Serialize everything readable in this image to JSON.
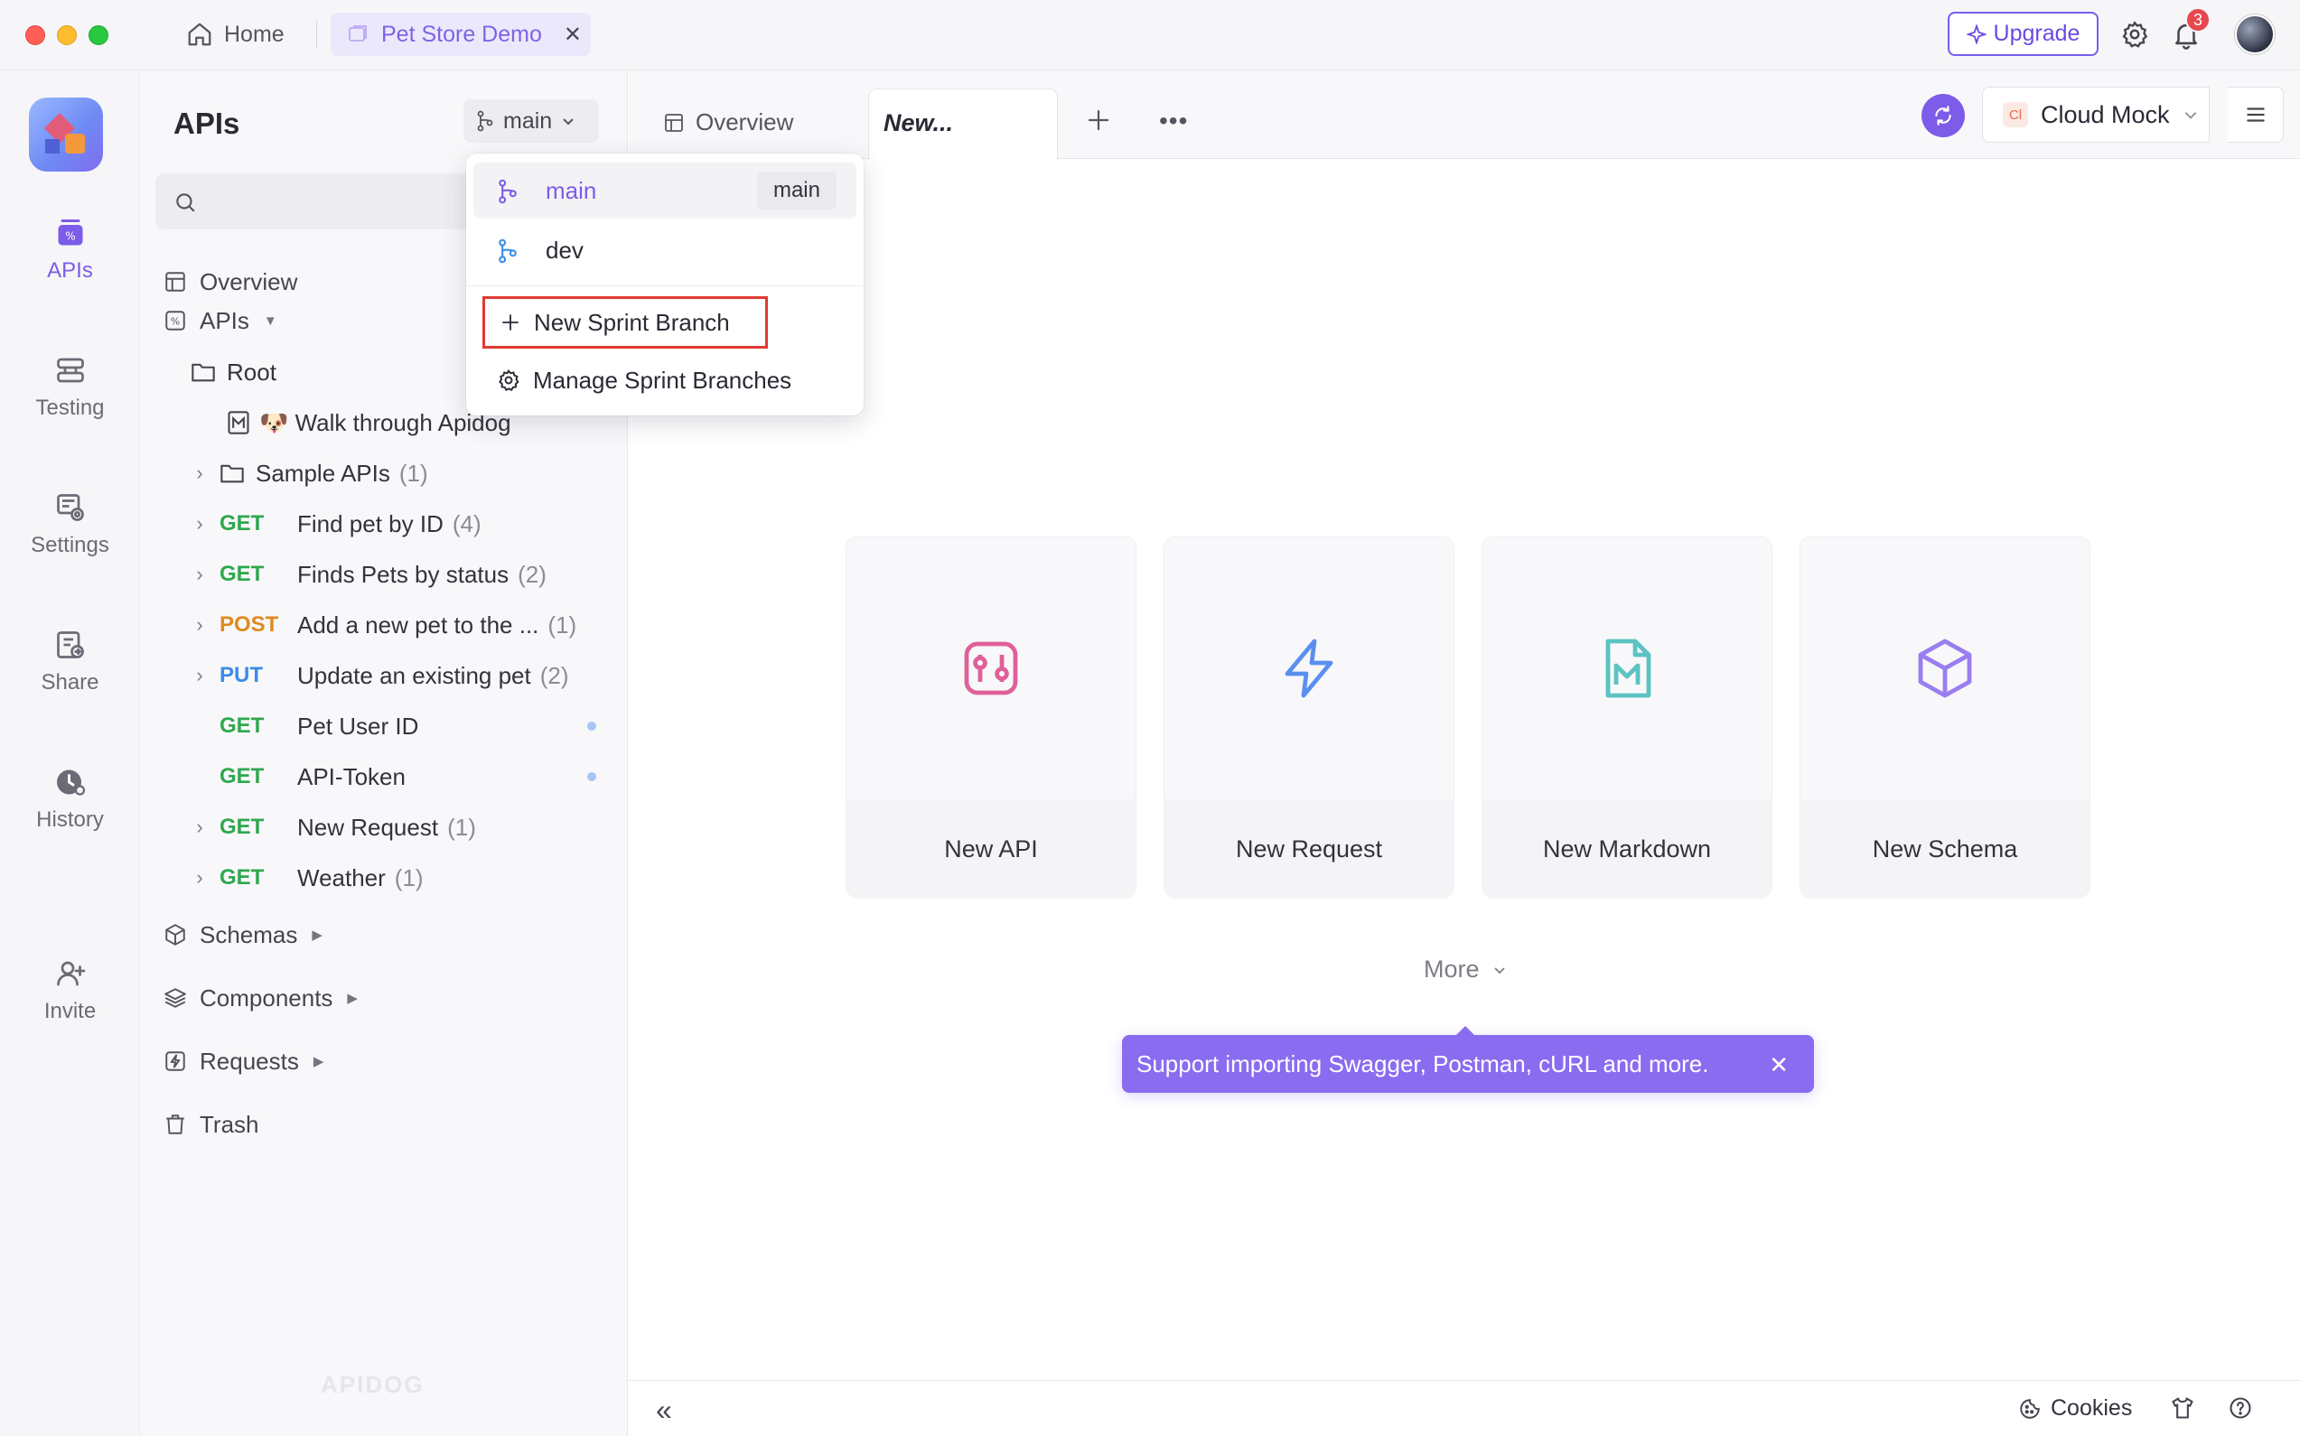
{
  "titlebar": {
    "home_label": "Home",
    "project_tab": "Pet Store Demo",
    "upgrade_label": "Upgrade",
    "notification_count": "3"
  },
  "rail": {
    "items": [
      {
        "label": "APIs",
        "icon": "apis-icon"
      },
      {
        "label": "Testing",
        "icon": "testing-icon"
      },
      {
        "label": "Settings",
        "icon": "settings-icon"
      },
      {
        "label": "Share",
        "icon": "share-icon"
      },
      {
        "label": "History",
        "icon": "history-icon"
      },
      {
        "label": "Invite",
        "icon": "invite-icon"
      }
    ]
  },
  "sidebar": {
    "title": "APIs",
    "branch": "main",
    "overview": "Overview",
    "apis_section": "APIs",
    "root": "Root",
    "walkthrough": "🐶 Walk through Apidog",
    "sample_apis": "Sample APIs",
    "sample_apis_count": "(1)",
    "endpoints": [
      {
        "method": "GET",
        "name": "Find pet by ID",
        "count": "(4)"
      },
      {
        "method": "GET",
        "name": "Finds Pets by status",
        "count": "(2)"
      },
      {
        "method": "POST",
        "name": "Add a new pet to the ...",
        "count": "(1)"
      },
      {
        "method": "PUT",
        "name": "Update an existing pet",
        "count": "(2)"
      },
      {
        "method": "GET",
        "name": "Pet User ID",
        "count": ""
      },
      {
        "method": "GET",
        "name": "API-Token",
        "count": ""
      },
      {
        "method": "GET",
        "name": "New Request",
        "count": "(1)"
      },
      {
        "method": "GET",
        "name": "Weather",
        "count": "(1)"
      }
    ],
    "sections": [
      "Schemas",
      "Components",
      "Requests",
      "Trash"
    ],
    "watermark": "APIDOG"
  },
  "branch_dropdown": {
    "branches": [
      {
        "name": "main",
        "tag": "main",
        "selected": true
      },
      {
        "name": "dev",
        "tag": "",
        "selected": false
      }
    ],
    "new_branch": "New Sprint Branch",
    "manage_branches": "Manage Sprint Branches"
  },
  "main": {
    "tabs": {
      "overview": "Overview",
      "current": "New..."
    },
    "environment": "Cloud Mock",
    "environment_badge": "Cl",
    "cards": [
      {
        "label": "New API",
        "icon": "api-icon",
        "color": "#e0609a"
      },
      {
        "label": "New Request",
        "icon": "lightning-icon",
        "color": "#5a8ff0"
      },
      {
        "label": "New Markdown",
        "icon": "markdown-icon",
        "color": "#5cc2c2"
      },
      {
        "label": "New Schema",
        "icon": "cube-icon",
        "color": "#9a7ef0"
      }
    ],
    "more_label": "More",
    "tip": "Support importing Swagger, Postman, cURL and more."
  },
  "footer": {
    "cookies": "Cookies"
  },
  "colors": {
    "accent": "#7c5ce8",
    "get": "#2fa84f",
    "post": "#e08a1e",
    "put": "#3c8be8",
    "highlight_border": "#e03a32"
  }
}
